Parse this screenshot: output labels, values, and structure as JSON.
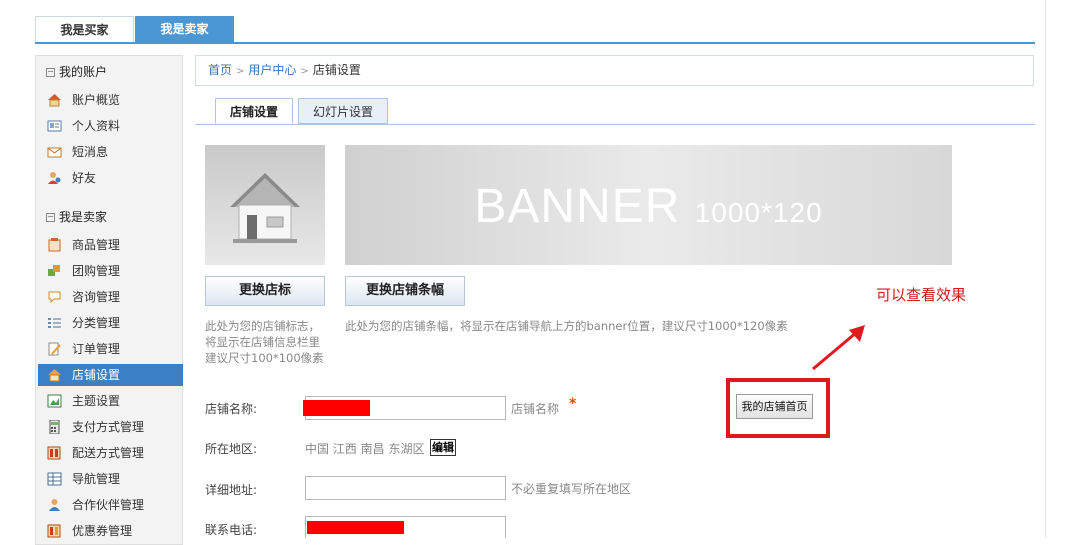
{
  "top_tabs": {
    "buyer": "我是买家",
    "seller": "我是卖家"
  },
  "sidebar": {
    "account_title": "我的账户",
    "account_items": [
      {
        "label": "账户概览",
        "icon": "home-icon"
      },
      {
        "label": "个人资料",
        "icon": "id-card-icon"
      },
      {
        "label": "短消息",
        "icon": "envelope-icon"
      },
      {
        "label": "好友",
        "icon": "friends-icon"
      }
    ],
    "seller_title": "我是卖家",
    "seller_items": [
      {
        "label": "商品管理",
        "icon": "goods-icon"
      },
      {
        "label": "团购管理",
        "icon": "puzzle-icon"
      },
      {
        "label": "咨询管理",
        "icon": "chat-bubble-icon"
      },
      {
        "label": "分类管理",
        "icon": "category-list-icon"
      },
      {
        "label": "订单管理",
        "icon": "order-edit-icon"
      },
      {
        "label": "店铺设置",
        "icon": "store-home-icon",
        "active": true
      },
      {
        "label": "主题设置",
        "icon": "theme-icon"
      },
      {
        "label": "支付方式管理",
        "icon": "calculator-icon"
      },
      {
        "label": "配送方式管理",
        "icon": "delivery-icon"
      },
      {
        "label": "导航管理",
        "icon": "nav-grid-icon"
      },
      {
        "label": "合作伙伴管理",
        "icon": "partner-icon"
      },
      {
        "label": "优惠券管理",
        "icon": "coupon-icon"
      }
    ]
  },
  "breadcrumb": {
    "home": "首页",
    "user_center": "用户中心",
    "current": "店铺设置"
  },
  "inner_tabs": {
    "store": "店铺设置",
    "slides": "幻灯片设置"
  },
  "banner_text": {
    "main": "BANNER",
    "size": "1000*120"
  },
  "buttons": {
    "change_logo": "更换店标",
    "change_banner": "更换店铺条幅",
    "edit": "编辑",
    "my_store_home": "我的店铺首页"
  },
  "hints": {
    "logo_lines": [
      "此处为您的店铺标志，",
      "将显示在店铺信息栏里",
      "建议尺寸100*100像素"
    ],
    "banner": "此处为您的店铺条幅，将显示在店铺导航上方的banner位置，建议尺寸1000*120像素"
  },
  "annotation": "可以查看效果",
  "form": {
    "store_name_label": "店铺名称:",
    "store_name_note": "店铺名称",
    "required_mark": "*",
    "region_label": "所在地区:",
    "region_value": "中国  江西  南昌  东湖区",
    "address_label": "详细地址:",
    "address_note": "不必重复填写所在地区",
    "phone_label": "联系电话:"
  },
  "colors": {
    "accent": "#4a97d3",
    "active_item": "#3b7fc4",
    "highlight_red": "#e0191f",
    "link": "#3a73b8"
  }
}
